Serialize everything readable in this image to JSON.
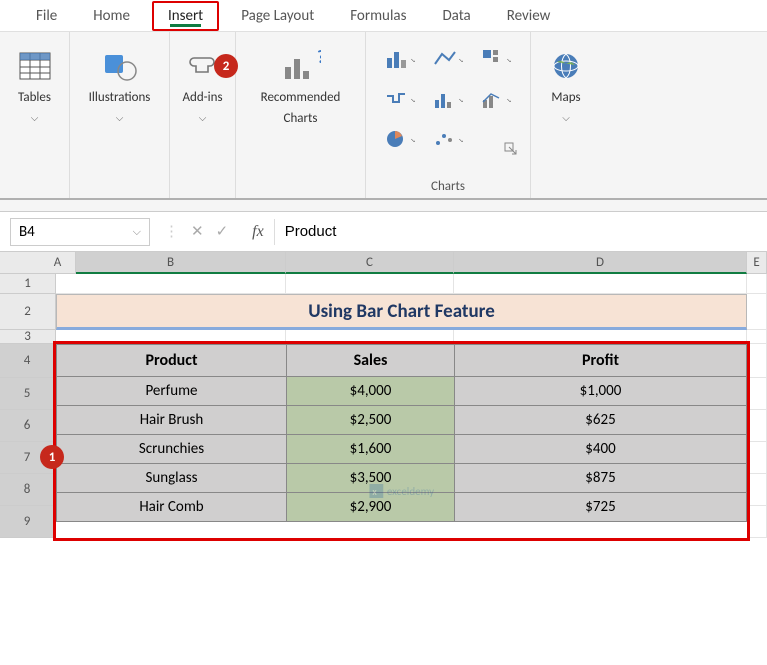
{
  "ribbon": {
    "tabs": [
      "File",
      "Home",
      "Insert",
      "Page Layout",
      "Formulas",
      "Data",
      "Review"
    ],
    "active_tab_index": 2,
    "groups": {
      "tables": {
        "label": "Tables"
      },
      "illustrations": {
        "label": "Illustrations"
      },
      "addins": {
        "label": "Add-ins"
      },
      "recommended": {
        "label_line1": "Recommended",
        "label_line2": "Charts"
      },
      "charts": {
        "label": "Charts"
      },
      "maps": {
        "label": "Maps"
      }
    }
  },
  "badges": {
    "step1": "1",
    "step2": "2"
  },
  "formula_bar": {
    "name_box": "B4",
    "fx": "fx",
    "value": "Product"
  },
  "columns": [
    "A",
    "B",
    "C",
    "D",
    "E"
  ],
  "rows": [
    "1",
    "2",
    "3",
    "4",
    "5",
    "6",
    "7",
    "8",
    "9"
  ],
  "title_cell": "Using Bar Chart Feature",
  "table": {
    "headers": [
      "Product",
      "Sales",
      "Profit"
    ],
    "rows": [
      {
        "product": "Perfume",
        "sales": "$4,000",
        "profit": "$1,000"
      },
      {
        "product": "Hair Brush",
        "sales": "$2,500",
        "profit": "$625"
      },
      {
        "product": "Scrunchies",
        "sales": "$1,600",
        "profit": "$400"
      },
      {
        "product": "Sunglass",
        "sales": "$3,500",
        "profit": "$875"
      },
      {
        "product": "Hair Comb",
        "sales": "$2,900",
        "profit": "$725"
      }
    ]
  },
  "watermark": "exceldemy"
}
